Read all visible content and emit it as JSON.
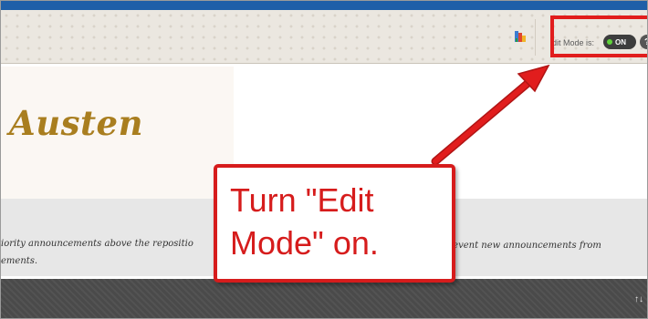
{
  "toolbar": {
    "edit_mode_label": "dit Mode is:",
    "toggle_label": "ON",
    "help_label": "?"
  },
  "course_banner": {
    "title": "Austen"
  },
  "announcements": {
    "text_line1_left": "iority announcements above the repositio",
    "text_line1_right": "prevent new announcements from",
    "text_line2": "ements."
  },
  "callout": {
    "line1": "Turn \"Edit",
    "line2": "Mode\" on."
  },
  "bottom_bar": {
    "sort_icon": "sort-arrows-icon",
    "sort_glyph": "↑↓"
  },
  "colors": {
    "annotation_red": "#e11d1d",
    "title_gold": "#a97e1f",
    "toggle_bg": "#3d3d3d",
    "toggle_indicator": "#5fd23a"
  }
}
